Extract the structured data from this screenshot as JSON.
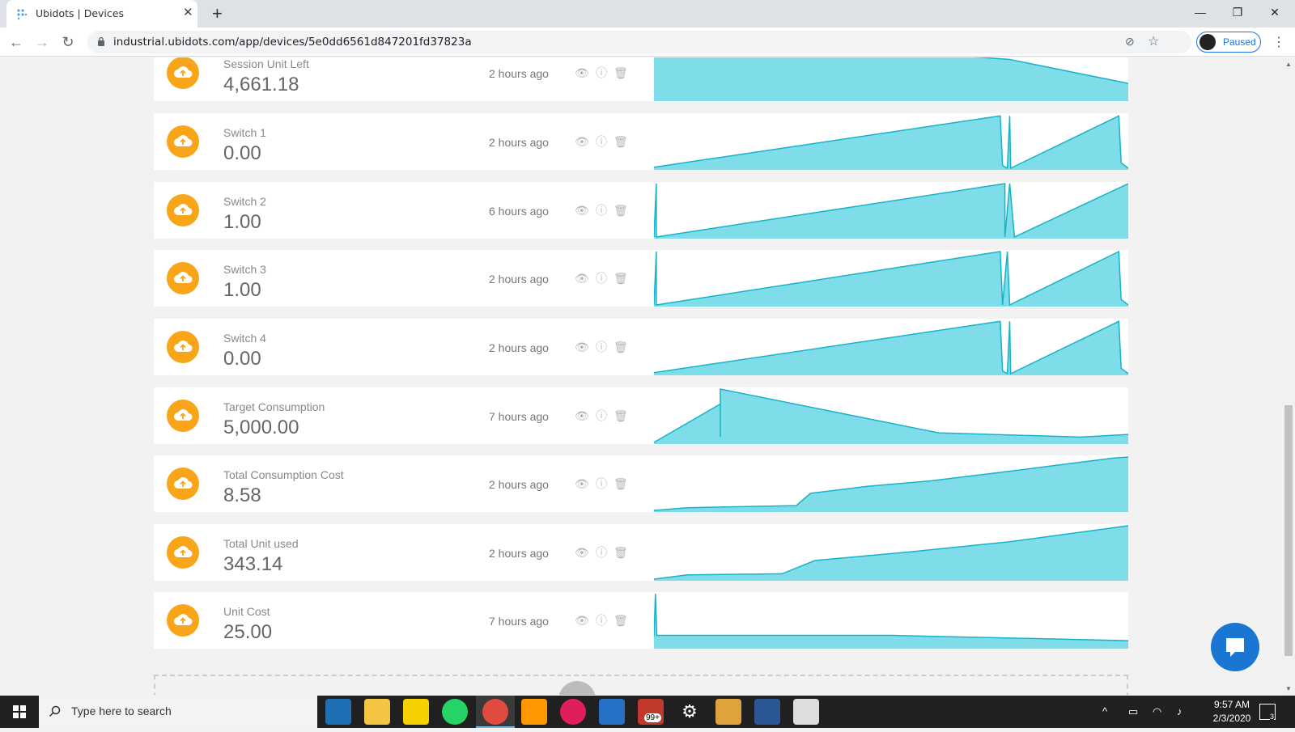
{
  "browser": {
    "tab_title": "Ubidots | Devices",
    "tab_close": "✕",
    "new_tab": "+",
    "url": "industrial.ubidots.com/app/devices/5e0dd6561d847201fd37823a",
    "profile_status": "Paused"
  },
  "variables": [
    {
      "name": "Session Unit Left",
      "value": "4,661.18",
      "time": "2 hours ago"
    },
    {
      "name": "Switch 1",
      "value": "0.00",
      "time": "2 hours ago"
    },
    {
      "name": "Switch 2",
      "value": "1.00",
      "time": "6 hours ago"
    },
    {
      "name": "Switch 3",
      "value": "1.00",
      "time": "2 hours ago"
    },
    {
      "name": "Switch 4",
      "value": "0.00",
      "time": "2 hours ago"
    },
    {
      "name": "Target Consumption",
      "value": "5,000.00",
      "time": "7 hours ago"
    },
    {
      "name": "Total Consumption Cost",
      "value": "8.58",
      "time": "2 hours ago"
    },
    {
      "name": "Total Unit used",
      "value": "343.14",
      "time": "2 hours ago"
    },
    {
      "name": "Unit Cost",
      "value": "25.00",
      "time": "7 hours ago"
    }
  ],
  "taskbar": {
    "search_placeholder": "Type here to search",
    "time": "9:57 AM",
    "date": "2/3/2020",
    "mail_badge": "99+",
    "notifications_count": "3"
  },
  "colors": {
    "sparkline_fill": "#7fdde9",
    "sparkline_stroke": "#17b3c9",
    "variable_icon": "#f9a51a",
    "chat_button": "#1976d2"
  }
}
